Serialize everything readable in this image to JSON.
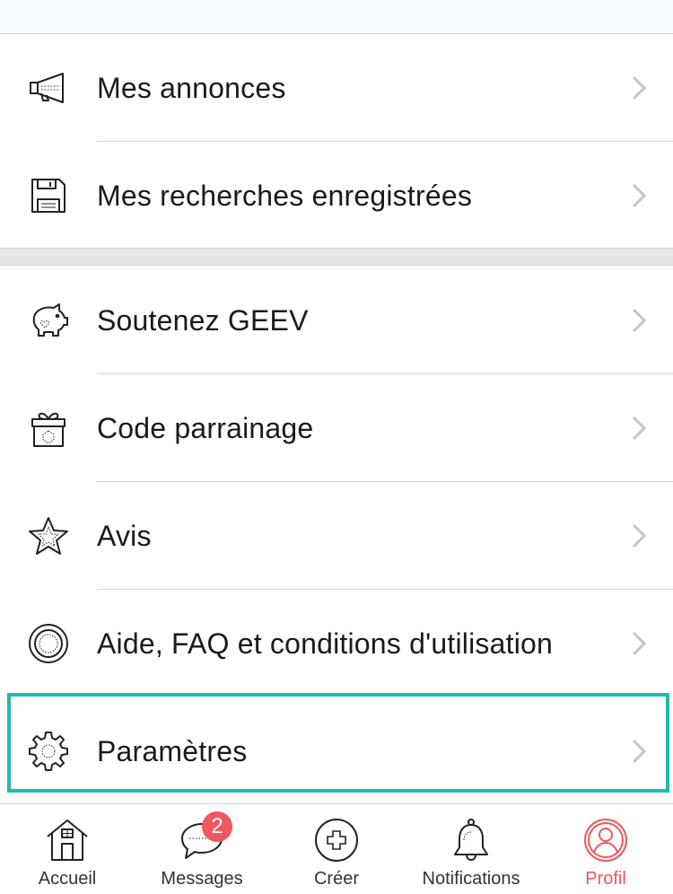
{
  "menu": {
    "group1": [
      {
        "label": "Mes annonces",
        "icon": "megaphone-icon"
      },
      {
        "label": "Mes recherches enregistrées",
        "icon": "floppy-disk-icon"
      }
    ],
    "group2": [
      {
        "label": "Soutenez GEEV",
        "icon": "piggy-bank-icon"
      },
      {
        "label": "Code parrainage",
        "icon": "gift-icon"
      },
      {
        "label": "Avis",
        "icon": "star-icon"
      },
      {
        "label": "Aide, FAQ et conditions d'utilisation",
        "icon": "lifebuoy-icon"
      },
      {
        "label": "Paramètres",
        "icon": "gear-icon"
      }
    ]
  },
  "tabbar": {
    "tabs": [
      {
        "label": "Accueil",
        "icon": "house-icon"
      },
      {
        "label": "Messages",
        "icon": "chat-bubble-icon",
        "badge": "2"
      },
      {
        "label": "Créer",
        "icon": "plus-circle-icon"
      },
      {
        "label": "Notifications",
        "icon": "bell-icon"
      },
      {
        "label": "Profil",
        "icon": "profile-icon",
        "active": true
      }
    ]
  },
  "colors": {
    "accent": "#f0575f",
    "highlight": "#1fbab0",
    "text": "#1a1a1a",
    "separator": "#d8d8d8"
  }
}
